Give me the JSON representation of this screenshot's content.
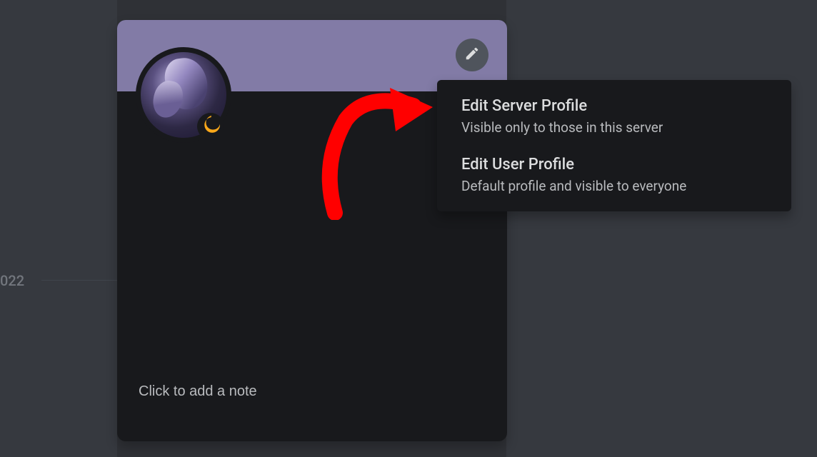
{
  "background": {
    "year_label": "022"
  },
  "profile": {
    "note_placeholder": "Click to add a note",
    "status": "idle"
  },
  "menu": {
    "items": [
      {
        "title": "Edit Server Profile",
        "subtitle": "Visible only to those in this server"
      },
      {
        "title": "Edit User Profile",
        "subtitle": "Default profile and visible to everyone"
      }
    ]
  }
}
